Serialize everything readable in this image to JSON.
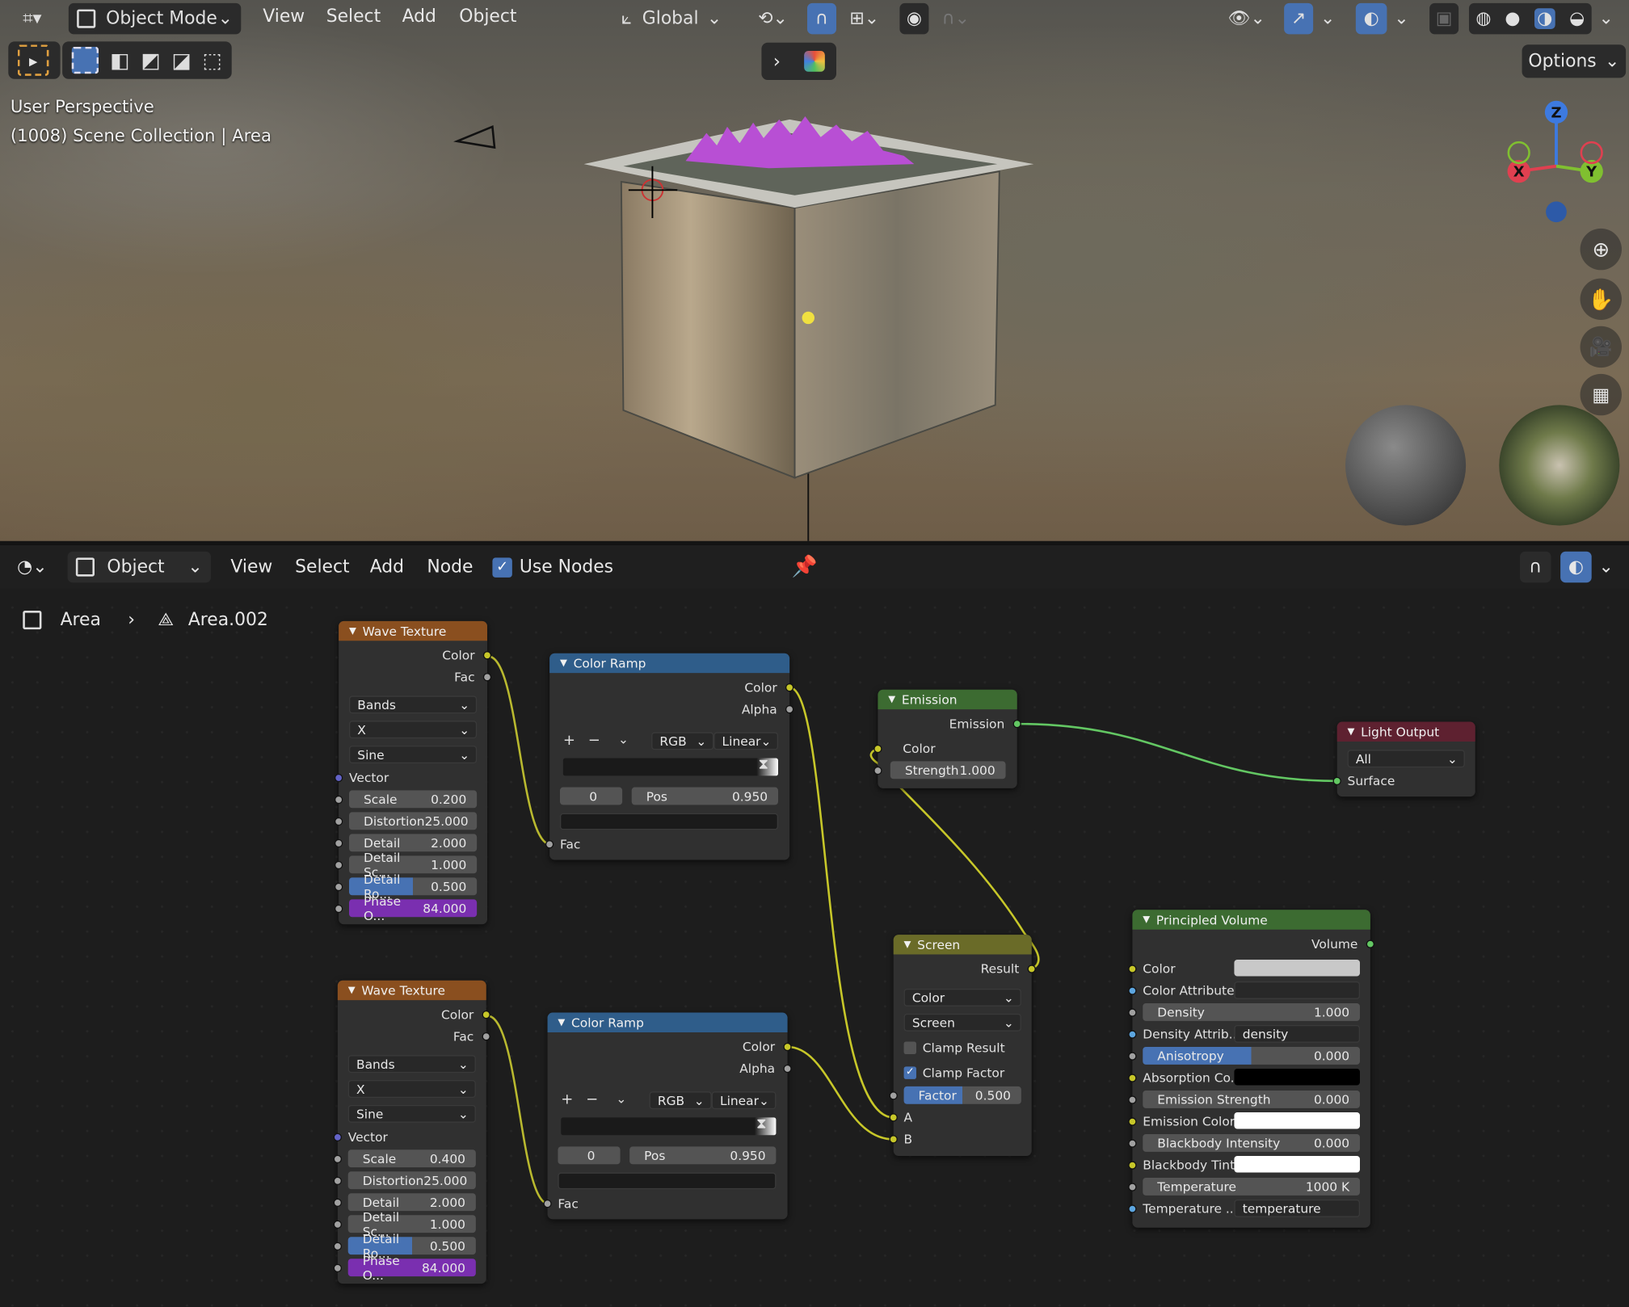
{
  "viewport": {
    "mode": "Object Mode",
    "menus": [
      "View",
      "Select",
      "Add",
      "Object"
    ],
    "orientation": "Global",
    "options": "Options",
    "overlay_line1": "User Perspective",
    "overlay_line2": "(1008) Scene Collection | Area",
    "gizmo": {
      "x": "X",
      "y": "Y",
      "z": "Z"
    }
  },
  "node_editor": {
    "object_type": "Object",
    "menus": [
      "View",
      "Select",
      "Add",
      "Node"
    ],
    "use_nodes": "Use Nodes",
    "breadcrumb": {
      "object": "Area",
      "data": "Area.002"
    }
  },
  "nodes": {
    "wave1": {
      "title": "Wave Texture",
      "out_color": "Color",
      "out_fac": "Fac",
      "bands": "Bands",
      "axis": "X",
      "profile": "Sine",
      "vector": "Vector",
      "scale_l": "Scale",
      "scale_v": "0.200",
      "dist_l": "Distortion",
      "dist_v": "25.000",
      "detail_l": "Detail",
      "detail_v": "2.000",
      "dsc_l": "Detail Sc...",
      "dsc_v": "1.000",
      "dro_l": "Detail Ro...",
      "dro_v": "0.500",
      "ph_l": "Phase O...",
      "ph_v": "84.000",
      "detail_roughness": 0.5
    },
    "wave2": {
      "title": "Wave Texture",
      "out_color": "Color",
      "out_fac": "Fac",
      "bands": "Bands",
      "axis": "X",
      "profile": "Sine",
      "vector": "Vector",
      "scale_l": "Scale",
      "scale_v": "0.400",
      "dist_l": "Distortion",
      "dist_v": "25.000",
      "detail_l": "Detail",
      "detail_v": "2.000",
      "dsc_l": "Detail Sc...",
      "dsc_v": "1.000",
      "dro_l": "Detail Ro...",
      "dro_v": "0.500",
      "ph_l": "Phase O...",
      "ph_v": "84.000",
      "detail_roughness": 0.5
    },
    "ramp1": {
      "title": "Color Ramp",
      "out_color": "Color",
      "out_alpha": "Alpha",
      "mode": "RGB",
      "interp": "Linear",
      "index": "0",
      "pos_l": "Pos",
      "pos_v": "0.950",
      "in_fac": "Fac"
    },
    "ramp2": {
      "title": "Color Ramp",
      "out_color": "Color",
      "out_alpha": "Alpha",
      "mode": "RGB",
      "interp": "Linear",
      "index": "0",
      "pos_l": "Pos",
      "pos_v": "0.950",
      "in_fac": "Fac"
    },
    "emission": {
      "title": "Emission",
      "out": "Emission",
      "color": "Color",
      "str_l": "Strength",
      "str_v": "1.000"
    },
    "light_output": {
      "title": "Light Output",
      "target": "All",
      "surface": "Surface"
    },
    "screen": {
      "title": "Screen",
      "out": "Result",
      "type": "Color",
      "blend": "Screen",
      "clamp_result": "Clamp Result",
      "clamp_factor": "Clamp Factor",
      "fac_l": "Factor",
      "fac_v": "0.500",
      "a": "A",
      "b": "B",
      "factor": 0.5
    },
    "volume": {
      "title": "Principled Volume",
      "out": "Volume",
      "color": "Color",
      "color_attr": "Color Attribute",
      "density_l": "Density",
      "density_v": "1.000",
      "dattr_l": "Density Attrib...",
      "dattr_v": "density",
      "aniso_l": "Anisotropy",
      "aniso_v": "0.000",
      "abs_l": "Absorption Co...",
      "emstr_l": "Emission Strength",
      "emstr_v": "0.000",
      "emcol_l": "Emission Color",
      "bbi_l": "Blackbody Intensity",
      "bbi_v": "0.000",
      "bbt_l": "Blackbody Tint",
      "temp_l": "Temperature",
      "temp_v": "1000 K",
      "tattr_l": "Temperature ...",
      "tattr_v": "temperature",
      "anisotropy_bar": 0.5,
      "color_hex": "#c8c8c8",
      "absorption_hex": "#000000",
      "emission_hex": "#ffffff",
      "tint_hex": "#ffffff"
    }
  },
  "colors": {
    "accent": "#4772b3",
    "texture": "#8a4f1f",
    "converter": "#2f5d8a",
    "shader": "#3c6b31",
    "output": "#5e2130",
    "color_node": "#6a6b28"
  }
}
